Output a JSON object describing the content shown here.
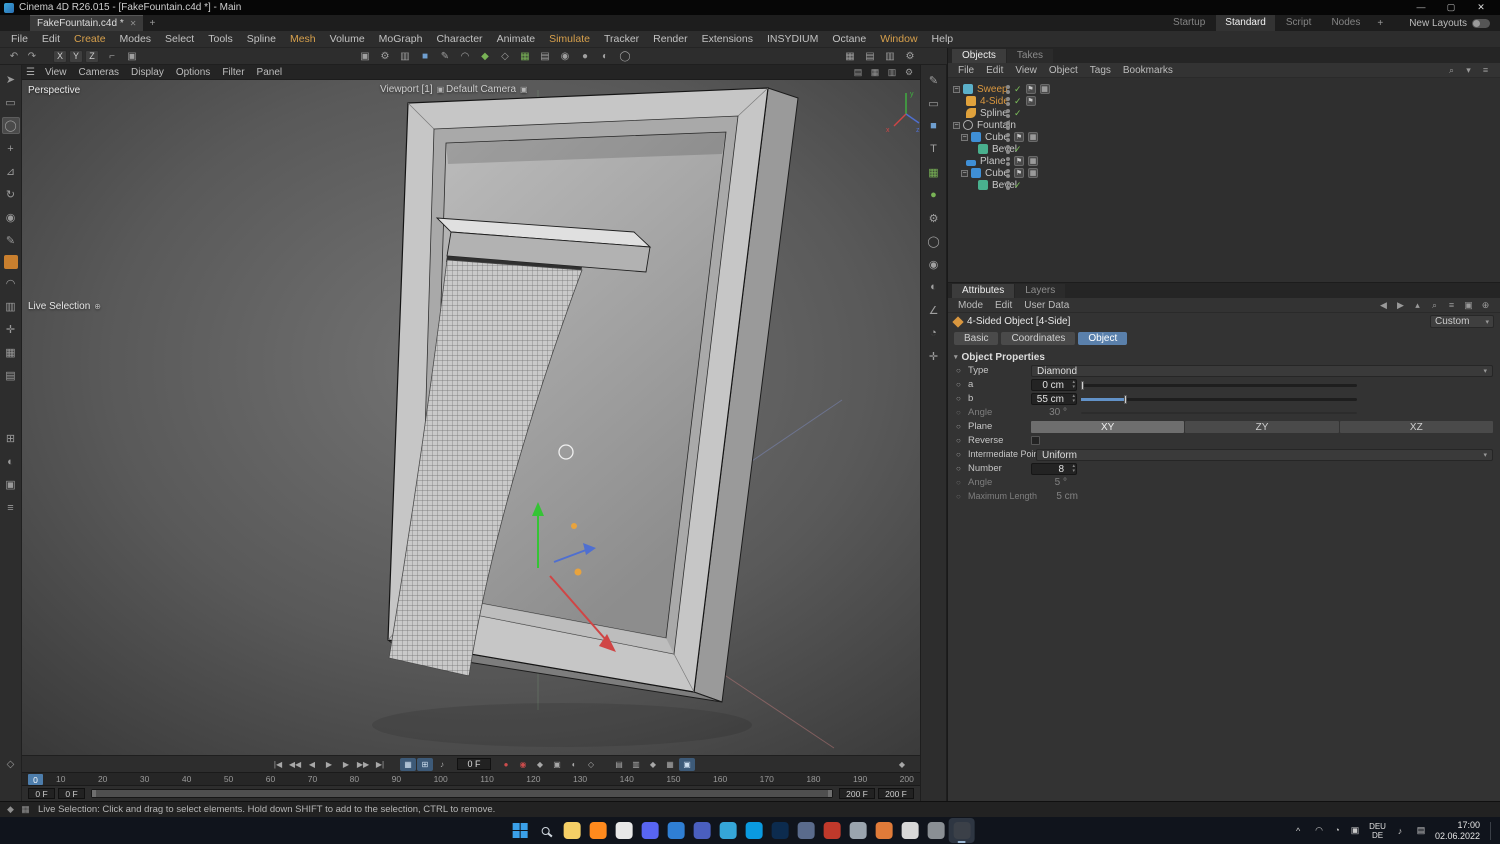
{
  "titlebar": {
    "title": "Cinema 4D R26.015 - [FakeFountain.c4d *] - Main",
    "window_controls": {
      "minimize": "—",
      "maximize": "▢",
      "close": "✕"
    }
  },
  "tabbar": {
    "document_tab": "FakeFountain.c4d *",
    "close_glyph": "✕",
    "new_tab_glyph": "+",
    "layout_tabs": [
      {
        "label": "Startup",
        "name": "layout-tab-startup"
      },
      {
        "label": "Standard",
        "name": "layout-tab-standard",
        "cls": "active"
      },
      {
        "label": "Script",
        "name": "layout-tab-script"
      },
      {
        "label": "Nodes",
        "name": "layout-tab-nodes"
      }
    ],
    "add_layout_glyph": "+",
    "new_layouts_label": "New Layouts"
  },
  "menubar": {
    "items": [
      {
        "label": "File",
        "name": "menu-file"
      },
      {
        "label": "Edit",
        "name": "menu-edit"
      },
      {
        "label": "Create",
        "name": "menu-create",
        "cls": "accent"
      },
      {
        "label": "Modes",
        "name": "menu-modes"
      },
      {
        "label": "Select",
        "name": "menu-select"
      },
      {
        "label": "Tools",
        "name": "menu-tools"
      },
      {
        "label": "Spline",
        "name": "menu-spline"
      },
      {
        "label": "Mesh",
        "name": "menu-mesh",
        "cls": "accent"
      },
      {
        "label": "Volume",
        "name": "menu-volume"
      },
      {
        "label": "MoGraph",
        "name": "menu-mograph"
      },
      {
        "label": "Character",
        "name": "menu-character"
      },
      {
        "label": "Animate",
        "name": "menu-animate"
      },
      {
        "label": "Simulate",
        "name": "menu-simulate",
        "cls": "accent"
      },
      {
        "label": "Tracker",
        "name": "menu-tracker"
      },
      {
        "label": "Render",
        "name": "menu-render"
      },
      {
        "label": "Extensions",
        "name": "menu-extensions"
      },
      {
        "label": "INSYDIUM",
        "name": "menu-insydium"
      },
      {
        "label": "Octane",
        "name": "menu-octane"
      },
      {
        "label": "Window",
        "name": "menu-window",
        "cls": "accent"
      },
      {
        "label": "Help",
        "name": "menu-help"
      }
    ]
  },
  "toolbar": {
    "undo_glyph": "↶",
    "redo_glyph": "↷",
    "axis_buttons": [
      {
        "label": "X",
        "name": "axis-x-button"
      },
      {
        "label": "Y",
        "name": "axis-y-button"
      },
      {
        "label": "Z",
        "name": "axis-z-button"
      }
    ],
    "left_icons": [
      {
        "name": "coord-system-icon",
        "glyph": "⌐"
      },
      {
        "name": "workplane-icon",
        "glyph": "▣"
      }
    ],
    "center_icons": [
      {
        "name": "render-view-icon",
        "glyph": "▣"
      },
      {
        "name": "render-settings-icon",
        "glyph": "⚙"
      },
      {
        "name": "render-queue-icon",
        "glyph": "▥"
      },
      {
        "name": "primitive-cube-icon",
        "glyph": "■",
        "cls": "c-blue"
      },
      {
        "name": "pen-tool-icon",
        "glyph": "✎"
      },
      {
        "name": "spline-primitive-icon",
        "glyph": "◠"
      },
      {
        "name": "subdivision-surface-icon",
        "glyph": "◆",
        "cls": "c-green"
      },
      {
        "name": "generator-icon",
        "glyph": "◇"
      },
      {
        "name": "array-icon",
        "glyph": "▦",
        "cls": "c-green"
      },
      {
        "name": "deformer-icon",
        "glyph": "▤"
      },
      {
        "name": "environment-icon",
        "glyph": "◉"
      },
      {
        "name": "camera-icon",
        "glyph": "●"
      },
      {
        "name": "light-icon",
        "glyph": "◐"
      },
      {
        "name": "material-ball-icon",
        "glyph": "◯"
      }
    ],
    "right_icons": [
      {
        "name": "display-mode-icon",
        "glyph": "▦"
      },
      {
        "name": "layout-split-icon",
        "glyph": "▤"
      },
      {
        "name": "panel-toggle-icon",
        "glyph": "▥"
      },
      {
        "name": "viewport-settings-gear-icon",
        "glyph": "⚙"
      }
    ]
  },
  "left_toolbar": {
    "primary_icons": [
      {
        "name": "select-arrow-icon",
        "glyph": "➤"
      },
      {
        "name": "box-select-icon",
        "glyph": "▭"
      },
      {
        "name": "live-selection-icon",
        "glyph": "◯",
        "cls": "active"
      },
      {
        "name": "move-tool-icon",
        "glyph": "+"
      },
      {
        "name": "scale-tool-icon",
        "glyph": "⊿"
      },
      {
        "name": "rotate-tool-icon",
        "glyph": "↻"
      },
      {
        "name": "last-tool-icon",
        "glyph": "◉"
      },
      {
        "name": "paint-tool-icon",
        "glyph": "✎"
      },
      {
        "name": "material-swatch-icon",
        "glyph": "■",
        "cls": "material"
      },
      {
        "name": "magnet-tool-icon",
        "glyph": "◠"
      },
      {
        "name": "mirror-tool-icon",
        "glyph": "▥"
      },
      {
        "name": "axis-mod-icon",
        "glyph": "✛"
      },
      {
        "name": "snap-icon",
        "glyph": "▦"
      },
      {
        "name": "workplane-mode-icon",
        "glyph": "▤"
      }
    ],
    "secondary_icons": [
      {
        "name": "grid-toggle-icon",
        "glyph": "⊞"
      },
      {
        "name": "view-filter-icon",
        "glyph": "◐"
      },
      {
        "name": "lock-view-icon",
        "glyph": "▣"
      },
      {
        "name": "layer-strip-icon",
        "glyph": "≡"
      }
    ]
  },
  "viewport": {
    "hamburger_glyph": "☰",
    "menu_items": [
      {
        "label": "View",
        "name": "vp-menu-view"
      },
      {
        "label": "Cameras",
        "name": "vp-menu-cameras"
      },
      {
        "label": "Display",
        "name": "vp-menu-display"
      },
      {
        "label": "Options",
        "name": "vp-menu-options"
      },
      {
        "label": "Filter",
        "name": "vp-menu-filter"
      },
      {
        "label": "Panel",
        "name": "vp-menu-panel"
      }
    ],
    "corner_icons": [
      {
        "name": "vp-single-view-icon",
        "glyph": "▤"
      },
      {
        "name": "vp-four-view-icon",
        "glyph": "▦"
      },
      {
        "name": "vp-camera-toggle-icon",
        "glyph": "▥"
      },
      {
        "name": "vp-settings-gear-icon",
        "glyph": "⚙"
      }
    ],
    "labels": {
      "perspective": "Perspective",
      "viewport": "Viewport [1]",
      "camera": "Default Camera",
      "tool": "Live Selection"
    },
    "axis_labels": {
      "x": "x",
      "y": "y",
      "z": "z"
    }
  },
  "object_manager": {
    "tabs": [
      {
        "label": "Objects",
        "name": "tab-objects",
        "cls": "active"
      },
      {
        "label": "Takes",
        "name": "tab-takes"
      }
    ],
    "menu_items": [
      {
        "label": "File",
        "name": "om-menu-file"
      },
      {
        "label": "Edit",
        "name": "om-menu-edit"
      },
      {
        "label": "View",
        "name": "om-menu-view"
      },
      {
        "label": "Object",
        "name": "om-menu-object"
      },
      {
        "label": "Tags",
        "name": "om-menu-tags"
      },
      {
        "label": "Bookmarks",
        "name": "om-menu-bookmarks"
      }
    ],
    "header_icons": [
      {
        "name": "om-search-icon",
        "glyph": "⌕"
      },
      {
        "name": "om-filter-icon",
        "glyph": "▾"
      },
      {
        "name": "om-list-icon",
        "glyph": "≡"
      }
    ],
    "tree": [
      {
        "label": "Sweep"
      },
      {
        "label": "4-Side"
      },
      {
        "label": "Spline"
      },
      {
        "label": "Fountain"
      },
      {
        "label": "Cube"
      },
      {
        "label": "Bevel"
      },
      {
        "label": "Plane"
      },
      {
        "label": "Cube"
      },
      {
        "label": "Bevel"
      }
    ]
  },
  "attributes": {
    "tabs": [
      {
        "label": "Attributes",
        "name": "tab-attributes",
        "cls": "active"
      },
      {
        "label": "Layers",
        "name": "tab-layers"
      }
    ],
    "menu_items": [
      {
        "label": "Mode",
        "name": "attr-menu-mode"
      },
      {
        "label": "Edit",
        "name": "attr-menu-edit"
      },
      {
        "label": "User Data",
        "name": "attr-menu-user-data"
      }
    ],
    "header_icons": [
      {
        "name": "attr-back-icon",
        "glyph": "◀"
      },
      {
        "name": "attr-forward-icon",
        "glyph": "▶"
      },
      {
        "name": "attr-parent-icon",
        "glyph": "▴"
      },
      {
        "name": "attr-search-icon",
        "glyph": "⌕"
      },
      {
        "name": "attr-filter-icon",
        "glyph": "≡"
      },
      {
        "name": "attr-lock-icon",
        "glyph": "▣"
      },
      {
        "name": "attr-new-icon",
        "glyph": "⊕"
      }
    ],
    "object_title": "4-Sided Object [4-Side]",
    "preset_value": "Custom",
    "section_tabs": [
      {
        "label": "Basic",
        "name": "section-tab-basic"
      },
      {
        "label": "Coordinates",
        "name": "section-tab-coordinates"
      },
      {
        "label": "Object",
        "name": "section-tab-object",
        "cls": "active"
      }
    ],
    "section_header": "Object Properties",
    "type": {
      "label": "Type",
      "value": "Diamond"
    },
    "a": {
      "label": "a",
      "value": "0 cm"
    },
    "b": {
      "label": "b",
      "value": "55 cm"
    },
    "angle_top": {
      "label": "Angle",
      "value": "30 °"
    },
    "plane": {
      "label": "Plane",
      "options": [
        {
          "label": "XY",
          "name": "plane-xy-button",
          "cls": "active"
        },
        {
          "label": "ZY",
          "name": "plane-zy-button"
        },
        {
          "label": "XZ",
          "name": "plane-xz-button"
        }
      ]
    },
    "reverse": {
      "label": "Reverse"
    },
    "intermediate_points": {
      "label": "Intermediate Points",
      "value": "Uniform"
    },
    "number": {
      "label": "Number",
      "value": "8"
    },
    "angle_bottom": {
      "label": "Angle",
      "value": "5 °"
    },
    "maximum_length": {
      "label": "Maximum Length",
      "value": "5 cm"
    }
  },
  "timeline": {
    "transport_icons": [
      {
        "name": "goto-start-button",
        "glyph": "|◀"
      },
      {
        "name": "prev-key-button",
        "glyph": "◀◀"
      },
      {
        "name": "prev-frame-button",
        "glyph": "◀"
      },
      {
        "name": "play-button",
        "glyph": "▶"
      },
      {
        "name": "next-frame-button",
        "glyph": "▶"
      },
      {
        "name": "next-key-button",
        "glyph": "▶▶"
      },
      {
        "name": "goto-end-button",
        "glyph": "▶|"
      }
    ],
    "toggle_icons": [
      {
        "name": "keyframe-selection-toggle",
        "glyph": "▦",
        "cls": "blue"
      },
      {
        "name": "reduced-modification-toggle",
        "glyph": "⊞",
        "cls": "blue"
      },
      {
        "name": "sound-toggle",
        "glyph": "♪"
      }
    ],
    "frame_value": "0 F",
    "record_icons": [
      {
        "name": "record-keyframe-button",
        "glyph": "●",
        "cls": "red"
      },
      {
        "name": "autokey-button",
        "glyph": "◉",
        "cls": "red"
      },
      {
        "name": "record-position-toggle",
        "glyph": "◆"
      },
      {
        "name": "record-scale-toggle",
        "glyph": "▣"
      },
      {
        "name": "record-rotation-toggle",
        "glyph": "◐"
      },
      {
        "name": "record-param-toggle",
        "glyph": "◇"
      }
    ],
    "option_icons": [
      {
        "name": "keyframe-presets-icon",
        "glyph": "▤"
      },
      {
        "name": "timeline-options-icon",
        "glyph": "▥"
      },
      {
        "name": "marker-icon",
        "glyph": "◆"
      },
      {
        "name": "snapshot-icon",
        "glyph": "▦"
      },
      {
        "name": "minimal-mode-toggle",
        "glyph": "▣",
        "cls": "blue"
      }
    ],
    "key_icon_glyph": "◆",
    "playhead_label": "0",
    "ruler_ticks": [
      "10",
      "20",
      "30",
      "40",
      "50",
      "60",
      "70",
      "80",
      "90",
      "100",
      "110",
      "120",
      "130",
      "140",
      "150",
      "160",
      "170",
      "180",
      "190",
      "200"
    ],
    "range_start_fields": [
      "0 F",
      "0 F"
    ],
    "range_end_fields": [
      "200 F",
      "200 F"
    ]
  },
  "statusbar": {
    "message": "Live Selection: Click and drag to select elements. Hold down SHIFT to add to the selection, CTRL to remove."
  },
  "taskbar": {
    "apps": [
      {
        "name": "taskbar-explorer-icon",
        "color": "#f5cf66"
      },
      {
        "name": "taskbar-firefox-icon",
        "color": "#ff8a1d"
      },
      {
        "name": "taskbar-chrome-icon",
        "color": "#e8e8e8"
      },
      {
        "name": "taskbar-discord-icon",
        "color": "#5865f2"
      },
      {
        "name": "taskbar-edge-icon",
        "color": "#2f7fd4"
      },
      {
        "name": "taskbar-teams-icon",
        "color": "#4a5fbf"
      },
      {
        "name": "taskbar-onedrive-icon",
        "color": "#35a6d8"
      },
      {
        "name": "taskbar-skype-icon",
        "color": "#0a9ae0"
      },
      {
        "name": "taskbar-photoshop-icon",
        "color": "#0c2b4e"
      },
      {
        "name": "taskbar-app-blue-icon",
        "color": "#5a6b8c"
      },
      {
        "name": "taskbar-acrobat-icon",
        "color": "#c0392b"
      },
      {
        "name": "taskbar-app-gray-icon",
        "color": "#9aa4ae"
      },
      {
        "name": "taskbar-blender-icon",
        "color": "#e07b39"
      },
      {
        "name": "taskbar-app-light-icon",
        "color": "#d8d8d8"
      },
      {
        "name": "taskbar-octane-icon",
        "color": "#8a8f94"
      },
      {
        "name": "taskbar-cinema4d-icon",
        "color": "#3b4048",
        "cls": "active"
      }
    ],
    "tray": {
      "chevron": "^",
      "icons": [
        {
          "name": "tray-network-icon",
          "glyph": "◠"
        },
        {
          "name": "tray-onedrive-icon",
          "glyph": "◔"
        },
        {
          "name": "tray-shield-icon",
          "glyph": "▣"
        }
      ],
      "lang_line1": "DEU",
      "lang_line2": "DE",
      "volume_glyph": "♪",
      "keyboard_glyph": "▤",
      "time": "17:00",
      "date": "02.06.2022"
    }
  },
  "status_icons": [
    {
      "name": "status-axis-icon",
      "glyph": "◆"
    },
    {
      "name": "status-grid-icon",
      "glyph": "▦"
    }
  ]
}
